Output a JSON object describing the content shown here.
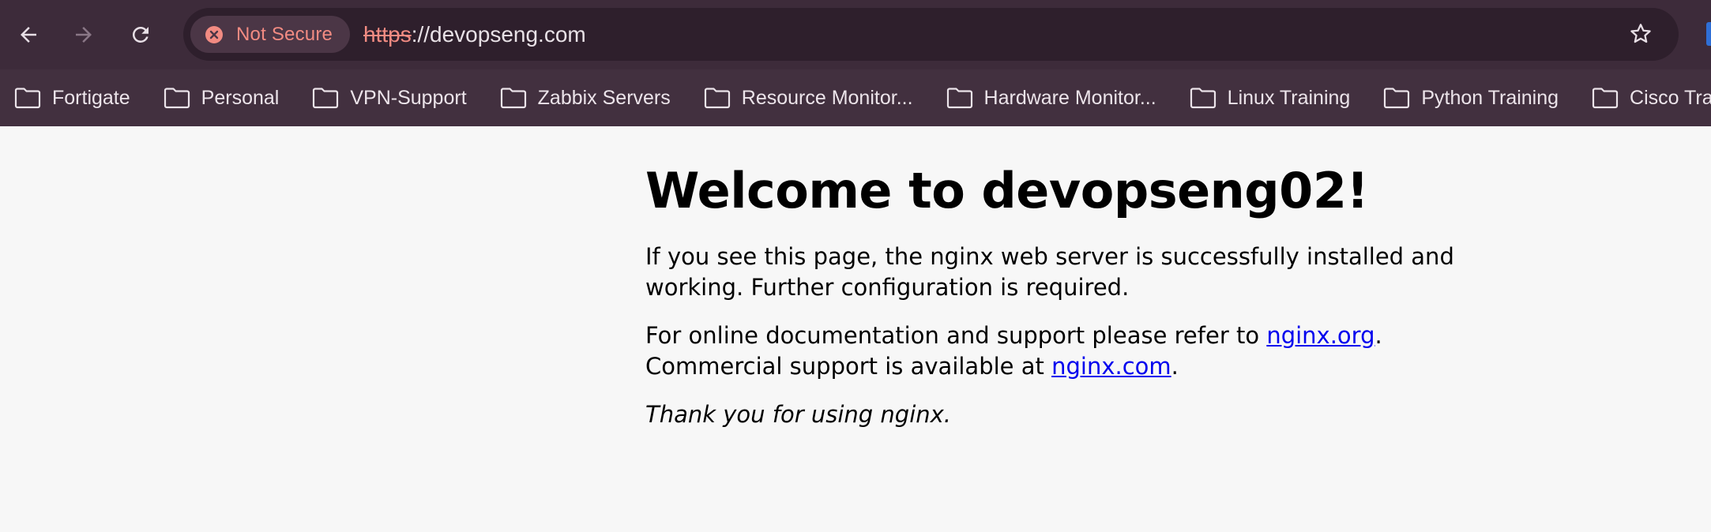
{
  "browser": {
    "nav": {
      "back_icon": "arrow-left-icon",
      "forward_icon": "arrow-right-icon",
      "reload_icon": "reload-icon"
    },
    "security_label": "Not Secure",
    "url_scheme": "https",
    "url_rest": "://devopseng.com",
    "bookmark_icon": "star-icon",
    "bookmarks": [
      {
        "label": "Fortigate",
        "icon": "folder-icon"
      },
      {
        "label": "Personal",
        "icon": "folder-icon"
      },
      {
        "label": "VPN-Support",
        "icon": "folder-icon"
      },
      {
        "label": "Zabbix Servers",
        "icon": "folder-icon"
      },
      {
        "label": "Resource Monitor...",
        "icon": "folder-icon"
      },
      {
        "label": "Hardware Monitor...",
        "icon": "folder-icon"
      },
      {
        "label": "Linux Training",
        "icon": "folder-icon"
      },
      {
        "label": "Python Training",
        "icon": "folder-icon"
      },
      {
        "label": "Cisco Training",
        "icon": "folder-icon"
      }
    ],
    "colors": {
      "toolbar": "#3d2b3a",
      "omnibox": "#2e1f2c",
      "warning": "#f28b82"
    }
  },
  "page": {
    "heading": "Welcome to devopseng02!",
    "para1": "If you see this page, the nginx web server is successfully installed and working. Further configuration is required.",
    "para2_prefix": "For online documentation and support please refer to ",
    "link_org": "nginx.org",
    "para2_mid": ".",
    "para2_line2_prefix": "Commercial support is available at ",
    "link_com": "nginx.com",
    "para2_suffix": ".",
    "thanks": "Thank you for using nginx."
  }
}
